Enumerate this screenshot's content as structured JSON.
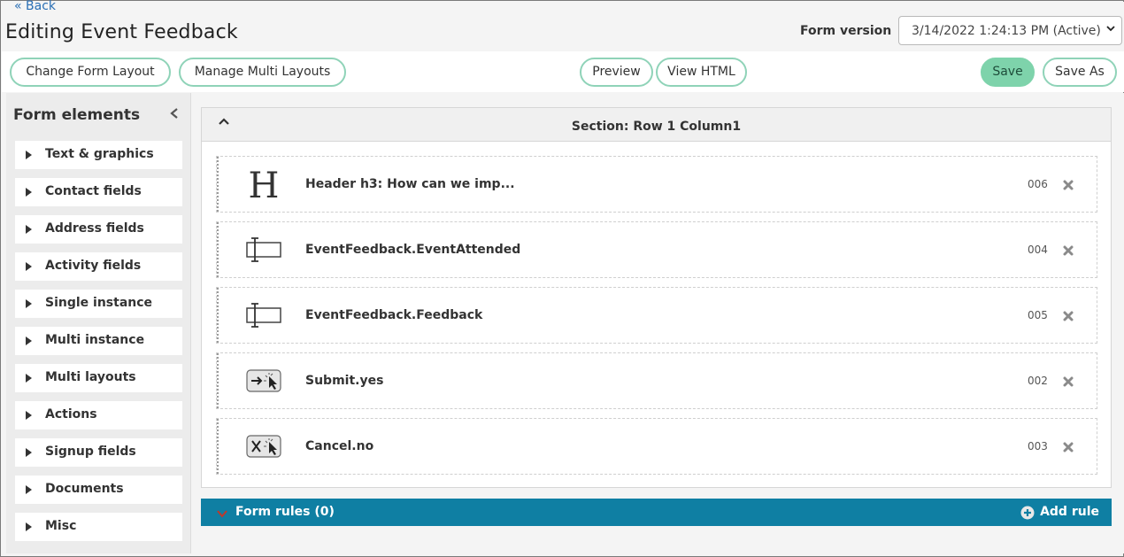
{
  "header": {
    "back_label": "« Back",
    "title": "Editing Event Feedback",
    "form_version_label": "Form version",
    "form_version_value": "3/14/2022 1:24:13 PM (Active)"
  },
  "toolbar": {
    "change_layout": "Change Form Layout",
    "manage_multi": "Manage Multi Layouts",
    "preview": "Preview",
    "view_html": "View HTML",
    "save": "Save",
    "save_as": "Save As"
  },
  "sidebar": {
    "title": "Form elements",
    "items": [
      {
        "label": "Text & graphics"
      },
      {
        "label": "Contact fields"
      },
      {
        "label": "Address fields"
      },
      {
        "label": "Activity fields"
      },
      {
        "label": "Single instance"
      },
      {
        "label": "Multi instance"
      },
      {
        "label": "Multi layouts"
      },
      {
        "label": "Actions"
      },
      {
        "label": "Signup fields"
      },
      {
        "label": "Documents"
      },
      {
        "label": "Misc"
      }
    ]
  },
  "section": {
    "title": "Section: Row 1 Column1",
    "fields": [
      {
        "icon": "header-icon",
        "label": "Header h3: How can we imp...",
        "code": "006"
      },
      {
        "icon": "text-field-icon",
        "label": "EventFeedback.EventAttended",
        "code": "004"
      },
      {
        "icon": "text-field-icon",
        "label": "EventFeedback.Feedback",
        "code": "005"
      },
      {
        "icon": "submit-button-icon",
        "label": "Submit.yes",
        "code": "002"
      },
      {
        "icon": "cancel-button-icon",
        "label": "Cancel.no",
        "code": "003"
      }
    ]
  },
  "rules": {
    "title": "Form rules (0)",
    "add_label": "Add rule"
  },
  "colors": {
    "accent_green": "#7ed3ab",
    "rules_bar": "#0f7fa3",
    "link_blue": "#2a6fb5"
  }
}
